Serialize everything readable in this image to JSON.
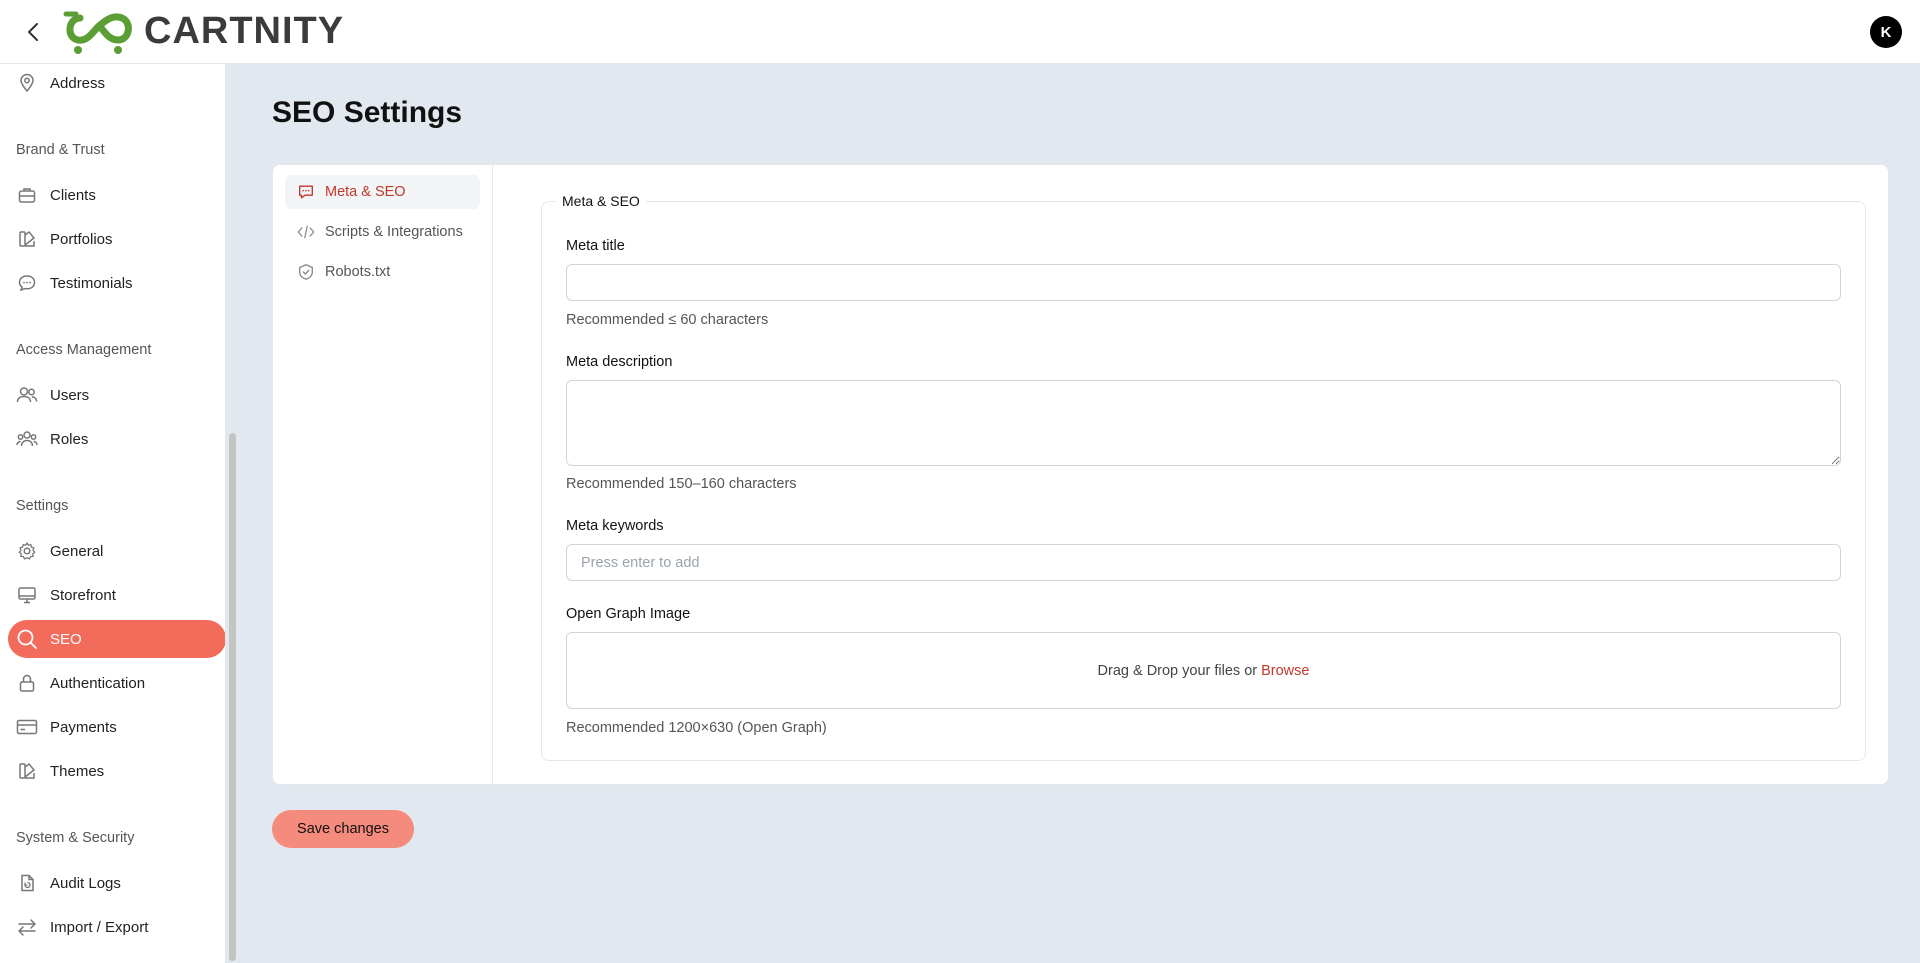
{
  "header": {
    "brand": "CARTNITY",
    "avatar_initial": "K"
  },
  "sidebar": {
    "items_top": [
      {
        "label": "Address",
        "icon": "map-pin-icon"
      }
    ],
    "sections": [
      {
        "title": "Brand & Trust",
        "items": [
          {
            "label": "Clients",
            "icon": "briefcase-icon"
          },
          {
            "label": "Portfolios",
            "icon": "swatch-icon"
          },
          {
            "label": "Testimonials",
            "icon": "chat-icon"
          }
        ]
      },
      {
        "title": "Access Management",
        "items": [
          {
            "label": "Users",
            "icon": "users-icon"
          },
          {
            "label": "Roles",
            "icon": "user-group-icon"
          }
        ]
      },
      {
        "title": "Settings",
        "items": [
          {
            "label": "General",
            "icon": "gear-icon"
          },
          {
            "label": "Storefront",
            "icon": "monitor-icon"
          },
          {
            "label": "SEO",
            "icon": "search-icon",
            "active": true
          },
          {
            "label": "Authentication",
            "icon": "lock-icon"
          },
          {
            "label": "Payments",
            "icon": "credit-card-icon"
          },
          {
            "label": "Themes",
            "icon": "swatch-icon"
          }
        ]
      },
      {
        "title": "System & Security",
        "items": [
          {
            "label": "Audit Logs",
            "icon": "log-icon"
          },
          {
            "label": "Import / Export",
            "icon": "arrows-exchange-icon"
          }
        ]
      }
    ]
  },
  "main": {
    "title": "SEO Settings",
    "tabs": [
      {
        "label": "Meta & SEO",
        "icon": "chat-icon",
        "active": true
      },
      {
        "label": "Scripts & Integrations",
        "icon": "code-icon"
      },
      {
        "label": "Robots.txt",
        "icon": "shield-icon"
      }
    ],
    "fieldset": {
      "legend": "Meta & SEO",
      "meta_title": {
        "label": "Meta title",
        "value": "",
        "hint": "Recommended ≤ 60 characters"
      },
      "meta_description": {
        "label": "Meta description",
        "value": "",
        "hint": "Recommended 150–160 characters"
      },
      "meta_keywords": {
        "label": "Meta keywords",
        "placeholder": "Press enter to add"
      },
      "og_image": {
        "label": "Open Graph Image",
        "drop_text": "Drag & Drop your files or",
        "browse": "Browse",
        "hint": "Recommended 1200×630 (Open Graph)"
      }
    },
    "save_label": "Save changes"
  },
  "colors": {
    "accent": "#f26b5b",
    "accent_text": "#c0392b",
    "save_button": "#f48b7c",
    "logo_green": "#5a9e34",
    "background": "#e2e8f0"
  }
}
